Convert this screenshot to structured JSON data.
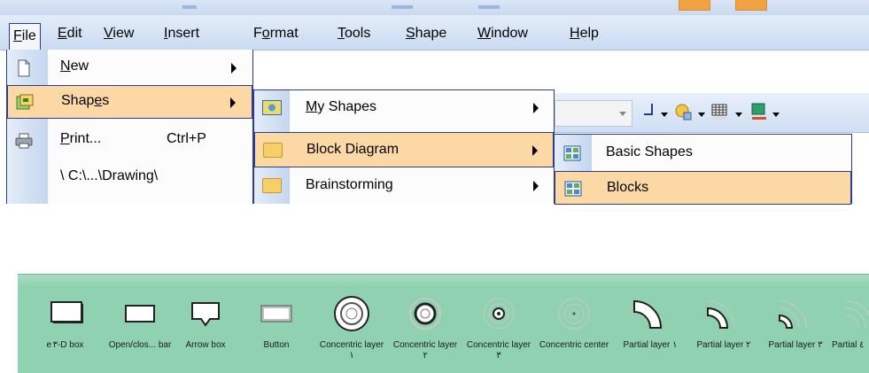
{
  "menubar": {
    "items": [
      {
        "label": "File",
        "key": "F",
        "rest": "ile",
        "active": true
      },
      {
        "label": "Edit",
        "key": "E",
        "rest": "dit"
      },
      {
        "label": "View",
        "key": "V",
        "rest": "iew"
      },
      {
        "label": "Insert",
        "key": "I",
        "rest": "nsert"
      },
      {
        "label": "Format",
        "pre": "F",
        "key": "o",
        "rest": "rmat"
      },
      {
        "label": "Tools",
        "key": "T",
        "rest": "ools"
      },
      {
        "label": "Shape",
        "key": "S",
        "rest": "hape"
      },
      {
        "label": "Window",
        "key": "W",
        "rest": "indow"
      },
      {
        "label": "Help",
        "key": "H",
        "rest": "elp"
      }
    ]
  },
  "file_menu": {
    "items": [
      {
        "key": "N",
        "rest": "ew",
        "icon": "new-document-icon",
        "submenu": true
      },
      {
        "pre": "Shap",
        "key": "e",
        "rest": "s",
        "icon": "shapes-icon",
        "submenu": true,
        "highlighted": true
      },
      {
        "key": "P",
        "rest": "rint...",
        "icon": "printer-icon",
        "shortcut": "Ctrl+P"
      },
      {
        "label": "\\ C:\\...\\Drawing\\",
        "icon": "none"
      }
    ]
  },
  "shapes_menu": {
    "items": [
      {
        "key": "M",
        "rest": "y Shapes",
        "icon": "my-shapes-icon",
        "submenu": true
      },
      {
        "label": "Block Diagram",
        "icon": "folder-icon",
        "submenu": true,
        "highlighted": true
      },
      {
        "label": "Brainstorming",
        "icon": "folder-icon",
        "submenu": true
      }
    ]
  },
  "block_menu": {
    "items": [
      {
        "label": "Basic Shapes",
        "icon": "stencil-icon"
      },
      {
        "label": "Blocks",
        "icon": "stencil-icon",
        "highlighted": true
      }
    ]
  },
  "stencil": {
    "items": [
      {
        "label": "e"
      },
      {
        "label": "٣-D box"
      },
      {
        "label": "Open/clos... bar"
      },
      {
        "label": "Arrow box"
      },
      {
        "label": "Button"
      },
      {
        "label": "Concentric layer ١"
      },
      {
        "label": "Concentric layer ٢"
      },
      {
        "label": "Concentric layer ٣"
      },
      {
        "label": "Concentric center"
      },
      {
        "label": "Partial layer ١"
      },
      {
        "label": "Partial layer ٢"
      },
      {
        "label": "Partial layer ٣"
      },
      {
        "label": "Partial ٤"
      }
    ]
  },
  "colors": {
    "highlight": "#fcd9a4",
    "menu_border": "#2e3a9a",
    "stencil_bg": "#8fd1b0",
    "accent_orange": "#f1a146"
  }
}
